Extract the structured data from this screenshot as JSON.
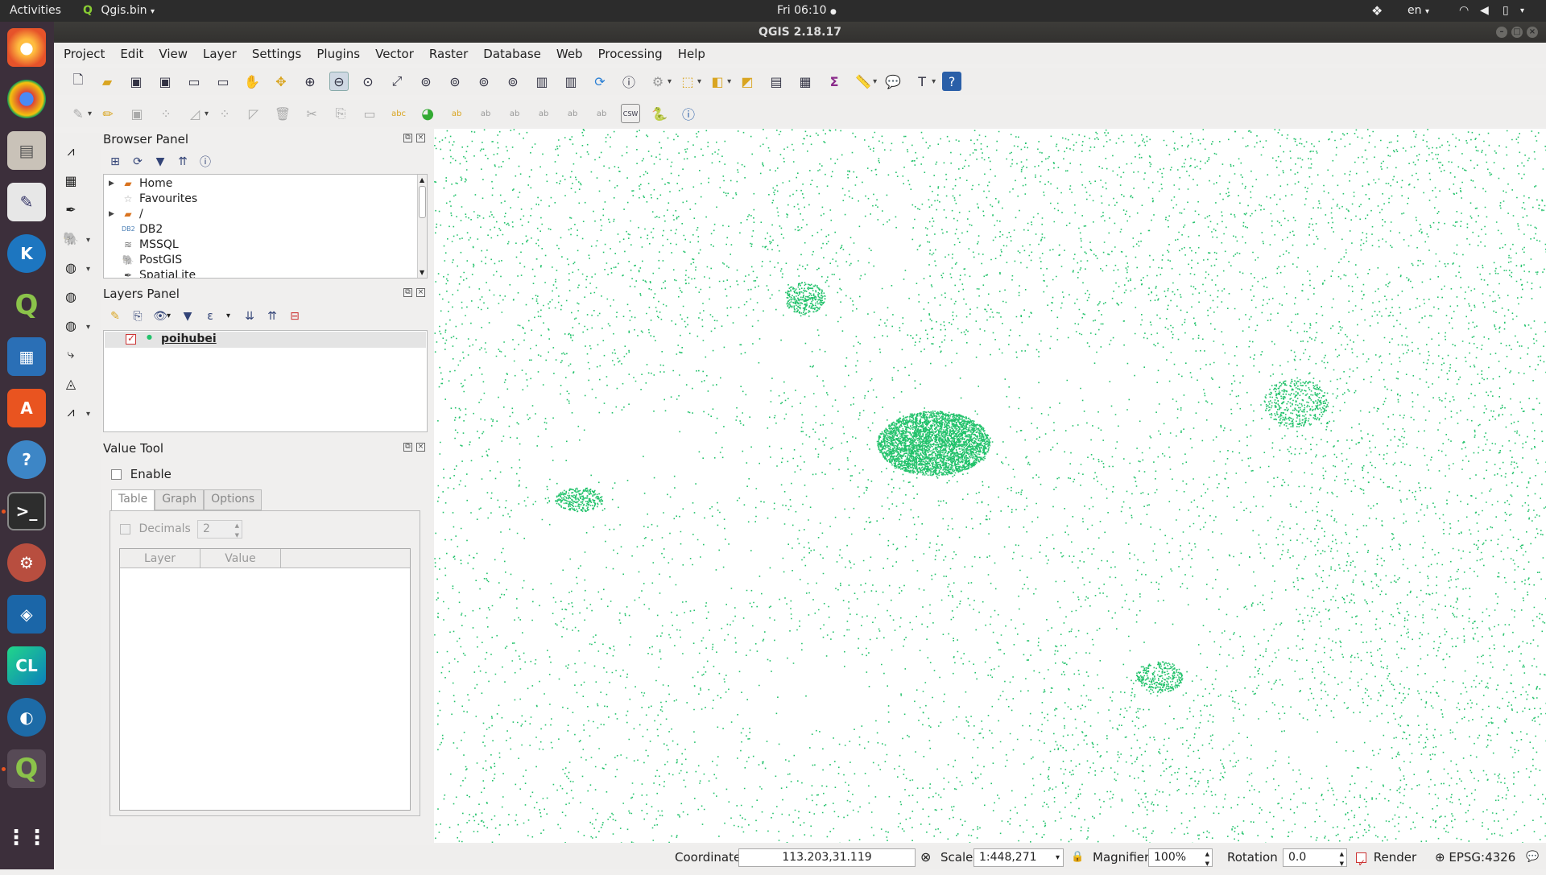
{
  "topbar": {
    "activities": "Activities",
    "app_name": "Qgis.bin",
    "clock": "Fri 06:10",
    "lang": "en"
  },
  "window": {
    "title": "QGIS 2.18.17"
  },
  "menu": [
    "Project",
    "Edit",
    "View",
    "Layer",
    "Settings",
    "Plugins",
    "Vector",
    "Raster",
    "Database",
    "Web",
    "Processing",
    "Help"
  ],
  "browser_panel": {
    "title": "Browser Panel",
    "items": [
      {
        "label": "Home",
        "icon": "folder-icon",
        "expandable": true
      },
      {
        "label": "Favourites",
        "icon": "star-icon",
        "expandable": false
      },
      {
        "label": "/",
        "icon": "folder-icon",
        "expandable": true
      },
      {
        "label": "DB2",
        "icon": "db2-icon",
        "expandable": false
      },
      {
        "label": "MSSQL",
        "icon": "mssql-icon",
        "expandable": false
      },
      {
        "label": "PostGIS",
        "icon": "postgis-icon",
        "expandable": false
      },
      {
        "label": "SpatiaLite",
        "icon": "spatialite-icon",
        "expandable": false
      }
    ]
  },
  "layers_panel": {
    "title": "Layers Panel",
    "layers": [
      {
        "name": "poihubei",
        "visible": true
      }
    ]
  },
  "value_tool": {
    "title": "Value Tool",
    "enable_label": "Enable",
    "tabs": [
      "Table",
      "Graph",
      "Options"
    ],
    "decimals_label": "Decimals",
    "decimals_value": "2",
    "columns": [
      "Layer",
      "Value"
    ]
  },
  "statusbar": {
    "coordinate_label": "Coordinate",
    "coordinate_value": "113.203,31.119",
    "scale_label": "Scale",
    "scale_value": "1:448,271",
    "magnifier_label": "Magnifier",
    "magnifier_value": "100%",
    "rotation_label": "Rotation",
    "rotation_value": "0.0",
    "render_label": "Render",
    "crs": "EPSG:4326"
  },
  "colors": {
    "point_fill": "#22c26b",
    "dock_bg": "#3c2f3b",
    "topbar_bg": "#2c2c2c"
  }
}
